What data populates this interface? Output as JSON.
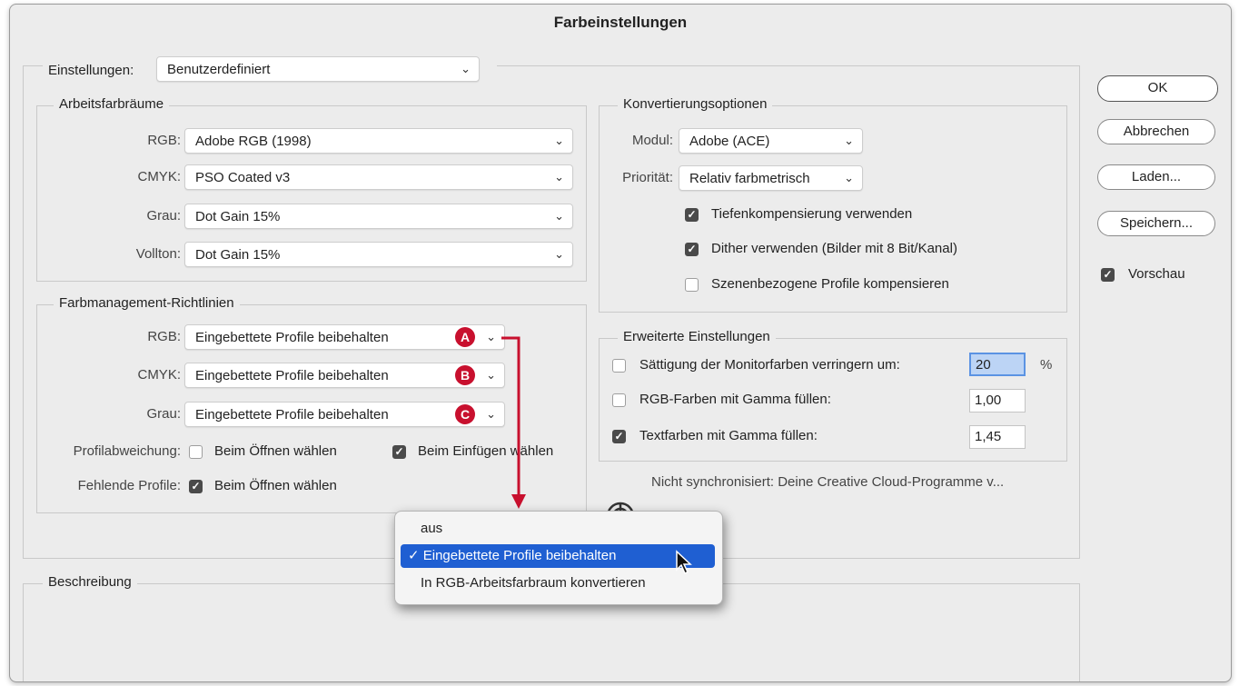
{
  "window": {
    "title": "Farbeinstellungen"
  },
  "settings": {
    "label": "Einstellungen:",
    "value": "Benutzerdefiniert"
  },
  "working_spaces": {
    "title": "Arbeitsfarbräume",
    "rows": [
      {
        "label": "RGB:",
        "value": "Adobe RGB (1998)"
      },
      {
        "label": "CMYK:",
        "value": "PSO Coated v3"
      },
      {
        "label": "Grau:",
        "value": "Dot Gain 15%"
      },
      {
        "label": "Vollton:",
        "value": "Dot Gain 15%"
      }
    ]
  },
  "policies": {
    "title": "Farbmanagement-Richtlinien",
    "rows": [
      {
        "label": "RGB:",
        "value": "Eingebettete Profile beibehalten",
        "badge": "A"
      },
      {
        "label": "CMYK:",
        "value": "Eingebettete Profile beibehalten",
        "badge": "B"
      },
      {
        "label": "Grau:",
        "value": "Eingebettete Profile beibehalten",
        "badge": "C"
      }
    ],
    "mismatch_label": "Profilabweichung:",
    "mismatch_open": {
      "label": "Beim Öffnen wählen",
      "checked": false
    },
    "mismatch_paste": {
      "label": "Beim Einfügen wählen",
      "checked": true
    },
    "missing_label": "Fehlende Profile:",
    "missing_open": {
      "label": "Beim Öffnen wählen",
      "checked": true
    }
  },
  "conversion": {
    "title": "Konvertierungsoptionen",
    "engine_label": "Modul:",
    "engine_value": "Adobe (ACE)",
    "intent_label": "Priorität:",
    "intent_value": "Relativ farbmetrisch",
    "options": [
      {
        "label": "Tiefenkompensierung verwenden",
        "checked": true
      },
      {
        "label": "Dither verwenden (Bilder mit 8 Bit/Kanal)",
        "checked": true
      },
      {
        "label": "Szenenbezogene Profile kompensieren",
        "checked": false
      }
    ]
  },
  "advanced": {
    "title": "Erweiterte Einstellungen",
    "rows": [
      {
        "label": "Sättigung der Monitorfarben verringern um:",
        "value": "20",
        "unit": "%",
        "checked": false
      },
      {
        "label": "RGB-Farben mit Gamma füllen:",
        "value": "1,00",
        "checked": false
      },
      {
        "label": "Textfarben mit Gamma füllen:",
        "value": "1,45",
        "checked": true
      }
    ]
  },
  "sync_status": "Nicht synchronisiert: Deine Creative Cloud-Programme v...",
  "description": {
    "title": "Beschreibung"
  },
  "buttons": {
    "ok": "OK",
    "cancel": "Abbrechen",
    "load": "Laden...",
    "save": "Speichern..."
  },
  "preview": {
    "label": "Vorschau",
    "checked": true
  },
  "popup_menu": {
    "items": [
      {
        "label": "aus",
        "selected": false
      },
      {
        "label": "Eingebettete Profile beibehalten",
        "selected": true
      },
      {
        "label": "In RGB-Arbeitsfarbraum konvertieren",
        "selected": false
      }
    ],
    "check_glyph": "✓"
  },
  "icons": {
    "chevron": "⌄",
    "check": "✓",
    "badge_color": "#c8102e",
    "highlight_color": "#1f5fd2"
  }
}
